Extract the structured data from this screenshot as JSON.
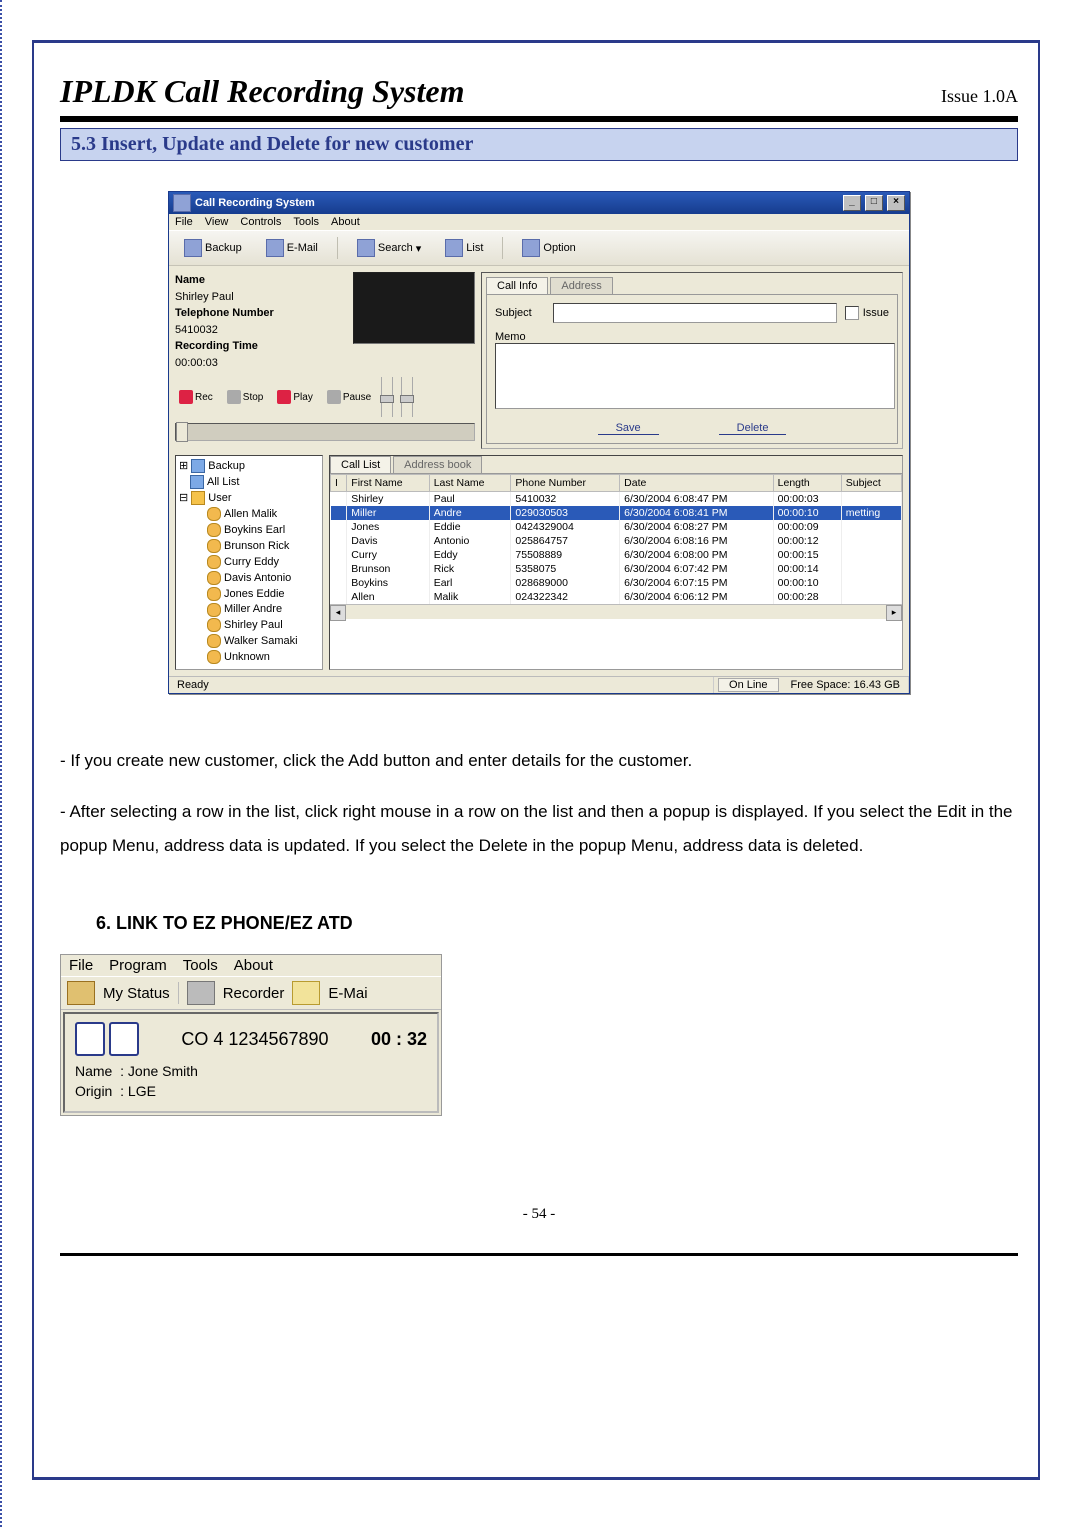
{
  "doc": {
    "title": "IPLDK Call Recording System",
    "issue": "Issue 1.0A",
    "section_heading": "5.3 Insert, Update and Delete for new customer",
    "page_number": "- 54 -"
  },
  "crs": {
    "window_title": "Call Recording System",
    "menus": [
      "File",
      "View",
      "Controls",
      "Tools",
      "About"
    ],
    "toolbar": {
      "backup": "Backup",
      "email": "E-Mail",
      "search": "Search",
      "list": "List",
      "option": "Option"
    },
    "player": {
      "name_label": "Name",
      "name_value": "Shirley Paul",
      "phone_label": "Telephone Number",
      "phone_value": "5410032",
      "rectime_label": "Recording Time",
      "rectime_value": "00:00:03",
      "rec": "Rec",
      "stop": "Stop",
      "play": "Play",
      "pause": "Pause"
    },
    "right_tabs": {
      "call_info": "Call Info",
      "address": "Address",
      "subject_label": "Subject",
      "issue_label": "Issue",
      "memo_label": "Memo",
      "save": "Save",
      "delete": "Delete"
    },
    "tree": {
      "backup": "Backup",
      "all_list": "All List",
      "user": "User",
      "items": [
        "Allen Malik",
        "Boykins Earl",
        "Brunson Rick",
        "Curry Eddy",
        "Davis Antonio",
        "Jones Eddie",
        "Miller Andre",
        "Shirley Paul",
        "Walker Samaki",
        "Unknown"
      ]
    },
    "grid": {
      "tab_calllist": "Call List",
      "tab_addrbook": "Address book",
      "headers": [
        "I",
        "First Name",
        "Last Name",
        "Phone Number",
        "Date",
        "Length",
        "Subject"
      ],
      "rows": [
        {
          "first": "Shirley",
          "last": "Paul",
          "phone": "5410032",
          "date": "6/30/2004 6:08:47 PM",
          "len": "00:00:03",
          "subj": ""
        },
        {
          "first": "Miller",
          "last": "Andre",
          "phone": "029030503",
          "date": "6/30/2004 6:08:41 PM",
          "len": "00:00:10",
          "subj": "metting",
          "selected": true
        },
        {
          "first": "Jones",
          "last": "Eddie",
          "phone": "0424329004",
          "date": "6/30/2004 6:08:27 PM",
          "len": "00:00:09",
          "subj": ""
        },
        {
          "first": "Davis",
          "last": "Antonio",
          "phone": "025864757",
          "date": "6/30/2004 6:08:16 PM",
          "len": "00:00:12",
          "subj": ""
        },
        {
          "first": "Curry",
          "last": "Eddy",
          "phone": "75508889",
          "date": "6/30/2004 6:08:00 PM",
          "len": "00:00:15",
          "subj": ""
        },
        {
          "first": "Brunson",
          "last": "Rick",
          "phone": "5358075",
          "date": "6/30/2004 6:07:42 PM",
          "len": "00:00:14",
          "subj": ""
        },
        {
          "first": "Boykins",
          "last": "Earl",
          "phone": "028689000",
          "date": "6/30/2004 6:07:15 PM",
          "len": "00:00:10",
          "subj": ""
        },
        {
          "first": "Allen",
          "last": "Malik",
          "phone": "024322342",
          "date": "6/30/2004 6:06:12 PM",
          "len": "00:00:28",
          "subj": ""
        }
      ]
    },
    "status": {
      "ready": "Ready",
      "online": "On Line",
      "freespace": "Free Space: 16.43 GB"
    }
  },
  "body_text": {
    "p1": "- If you create new customer, click the Add button and enter details for the customer.",
    "p2": "- After selecting a row in the list, click right mouse in a row on the list and then a popup is displayed. If you select the Edit in the popup Menu, address data is updated. If you select the Delete in the popup Menu, address data is deleted."
  },
  "section6_heading": "6.  LINK TO EZ PHONE/EZ ATD",
  "ezphone": {
    "menus": [
      "File",
      "Program",
      "Tools",
      "About"
    ],
    "toolbar": {
      "mystatus": "My Status",
      "recorder": "Recorder",
      "email": "E-Mai"
    },
    "call": {
      "line": "CO  4 1234567890",
      "timer": "00 : 32",
      "name_label": "Name",
      "name_value": "Jone Smith",
      "origin_label": "Origin",
      "origin_value": "LGE"
    }
  }
}
